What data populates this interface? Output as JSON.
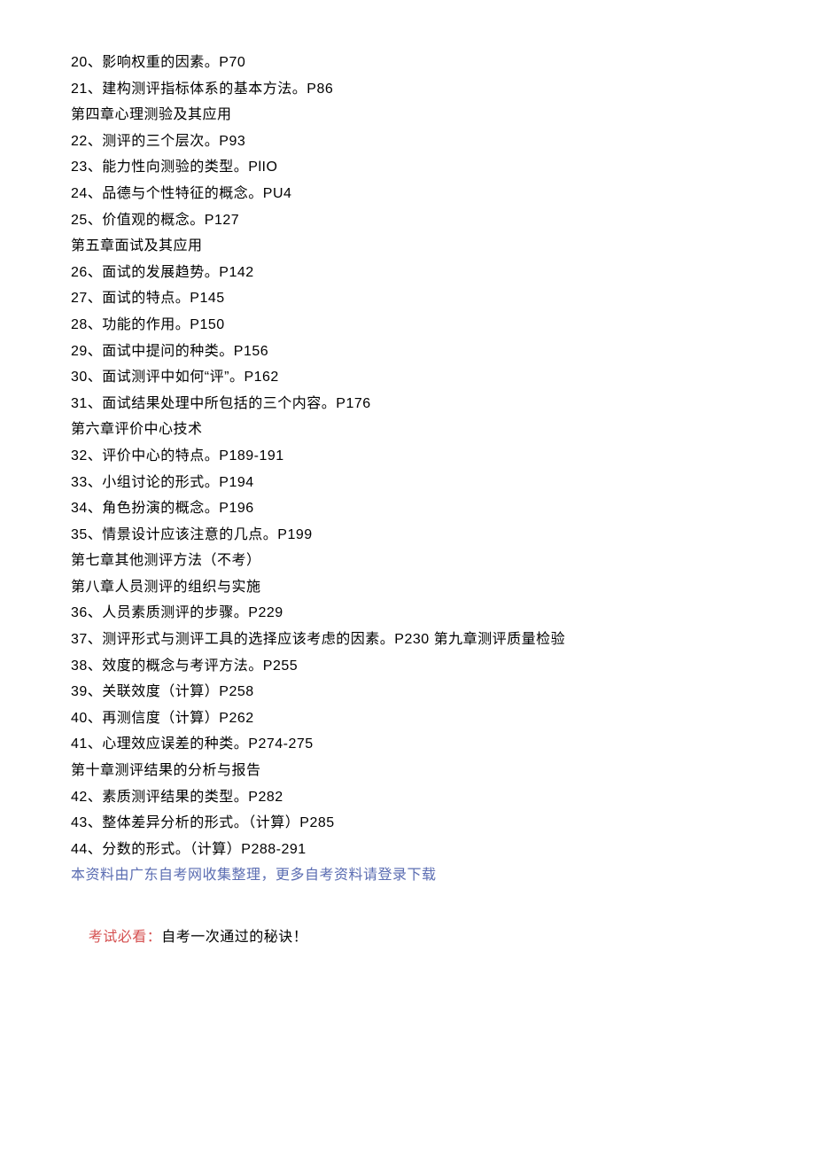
{
  "lines": [
    "20、影响权重的因素。P70",
    "21、建构测评指标体系的基本方法。P86",
    "第四章心理测验及其应用",
    "22、测评的三个层次。P93",
    "23、能力性向测验的类型。PlIO",
    "24、品德与个性特征的概念。PU4",
    "25、价值观的概念。P127",
    "第五章面试及其应用",
    "26、面试的发展趋势。P142",
    "27、面试的特点。P145",
    "28、功能的作用。P150",
    "29、面试中提问的种类。P156",
    "30、面试测评中如何“评”。P162",
    "31、面试结果处理中所包括的三个内容。P176",
    "第六章评价中心技术",
    "32、评价中心的特点。P189-191",
    "33、小组讨论的形式。P194",
    "34、角色扮演的概念。P196",
    "35、情景设计应该注意的几点。P199",
    "第七章其他测评方法（不考）",
    "第八章人员测评的组织与实施",
    "36、人员素质测评的步骤。P229",
    "37、测评形式与测评工具的选择应该考虑的因素。P230 第九章测评质量检验",
    "38、效度的概念与考评方法。P255",
    "39、关联效度（计算）P258",
    "40、再测信度（计算）P262",
    "41、心理效应误差的种类。P274-275",
    "第十章测评结果的分析与报告",
    "42、素质测评结果的类型。P282",
    "43、整体差异分析的形式。（计算）P285",
    "44、分数的形式。（计算）P288-291"
  ],
  "footer_blue": "本资料由广东自考网收集整理，更多自考资料请登录下载",
  "footer_red": "考试必看：",
  "footer_black": "自考一次通过的秘诀！"
}
